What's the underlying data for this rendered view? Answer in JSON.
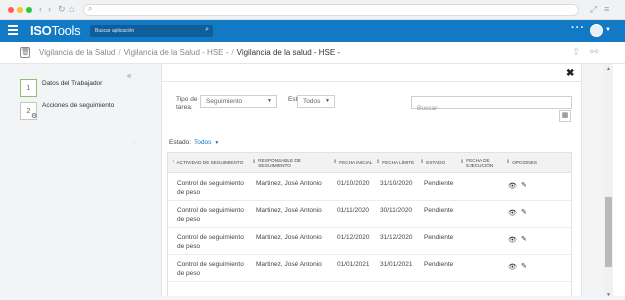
{
  "browser": {
    "traffic_lights": [
      "#ff5f57",
      "#febc2e",
      "#28c840"
    ],
    "nav_icons": [
      "back-icon",
      "forward-icon",
      "reload-icon"
    ]
  },
  "header": {
    "logo_bold": "ISO",
    "logo_thin": "Tools",
    "search_placeholder": "Buscar aplicación",
    "more_label": "···",
    "accent": "#1279c4"
  },
  "breadcrumb": {
    "items": [
      "Vigilancia de la Salud",
      "Vigilancia de la Salud - HSE -",
      "Vigilancia de la salud - HSE -"
    ],
    "separator": "/"
  },
  "left_panel": {
    "steps": [
      {
        "number": "1",
        "label": "Datos del Trabajador"
      },
      {
        "number": "2",
        "label": "Acciones de seguimiento"
      }
    ]
  },
  "filters": {
    "tipo_label": "Tipo de tarea:",
    "tipo_value": "Seguimiento",
    "estado_label_cut": "Est",
    "estado_value": "Todos",
    "search_placeholder": "Buscar"
  },
  "status_filter": {
    "label": "Estado:",
    "value": "Todos"
  },
  "table": {
    "columns": [
      "Actividad de seguimiento",
      "Responsable de seguimiento",
      "Fecha inicial",
      "Fecha límite",
      "Estado",
      "Fecha de ejecución",
      "Opciones"
    ],
    "rows": [
      {
        "actividad": "Control de seguimiento de peso",
        "responsable": "Martinez, José Antonio",
        "inicio": "01/10/2020",
        "limite": "31/10/2020",
        "estado": "Pendiente"
      },
      {
        "actividad": "Control de seguimiento de peso",
        "responsable": "Martinez, José Antonio",
        "inicio": "01/11/2020",
        "limite": "30/11/2020",
        "estado": "Pendiente"
      },
      {
        "actividad": "Control de seguimiento de peso",
        "responsable": "Martinez, José Antonio",
        "inicio": "01/12/2020",
        "limite": "31/12/2020",
        "estado": "Pendiente"
      },
      {
        "actividad": "Control de seguimiento de peso",
        "responsable": "Martinez, José Antonio",
        "inicio": "01/01/2021",
        "limite": "31/01/2021",
        "estado": "Pendiente"
      }
    ]
  }
}
